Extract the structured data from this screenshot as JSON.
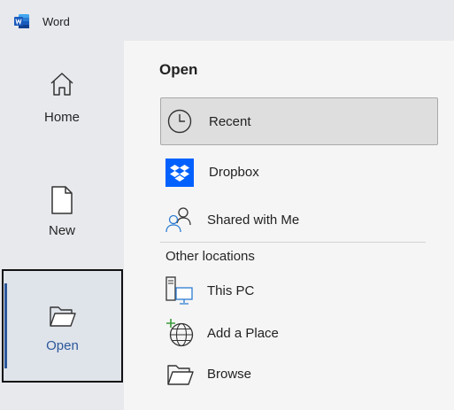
{
  "app": {
    "title": "Word",
    "logo_icon": "word-logo-icon",
    "brand_color": "#2b579a"
  },
  "sidebar": {
    "items": [
      {
        "label": "Home",
        "icon": "home-icon",
        "selected": false
      },
      {
        "label": "New",
        "icon": "new-document-icon",
        "selected": false
      },
      {
        "label": "Open",
        "icon": "open-folder-icon",
        "selected": true
      }
    ]
  },
  "main": {
    "title": "Open",
    "locations": [
      {
        "label": "Recent",
        "icon": "clock-icon",
        "selected": true
      },
      {
        "label": "Dropbox",
        "icon": "dropbox-icon",
        "selected": false,
        "color": "#0061fe"
      },
      {
        "label": "Shared with Me",
        "icon": "people-icon",
        "selected": false
      }
    ],
    "other_locations_label": "Other locations",
    "other_locations": [
      {
        "label": "This PC",
        "icon": "computer-icon"
      },
      {
        "label": "Add a Place",
        "icon": "globe-add-icon"
      },
      {
        "label": "Browse",
        "icon": "folder-icon"
      }
    ]
  }
}
